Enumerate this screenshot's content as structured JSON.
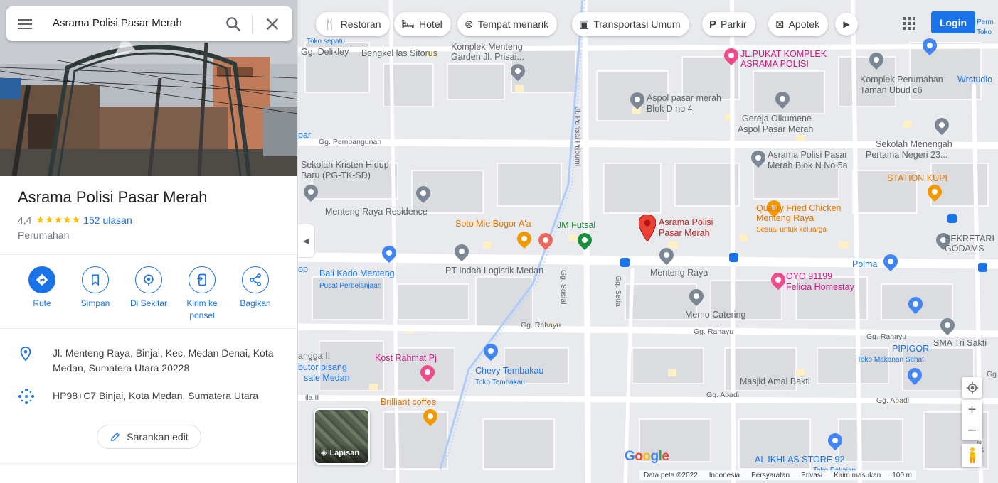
{
  "search": {
    "query": "Asrama Polisi Pasar Merah"
  },
  "place": {
    "name": "Asrama Polisi Pasar Merah",
    "rating": "4,4",
    "stars": "★★★★★",
    "reviews": "152 ulasan",
    "category": "Perumahan",
    "address": "Jl. Menteng Raya, Binjai, Kec. Medan Denai, Kota Medan, Sumatera Utara 20228",
    "plus_code": "HP98+C7 Binjai, Kota Medan, Sumatera Utara",
    "suggest_edit": "Sarankan edit"
  },
  "actions": [
    {
      "label": "Rute",
      "icon": "directions-icon"
    },
    {
      "label": "Simpan",
      "icon": "bookmark-icon"
    },
    {
      "label": "Di Sekitar",
      "icon": "nearby-icon"
    },
    {
      "label": "Kirim ke ponsel",
      "icon": "send-to-phone-icon"
    },
    {
      "label": "Bagikan",
      "icon": "share-icon"
    }
  ],
  "chips": [
    {
      "label": "Restoran",
      "icon": "restaurant-icon"
    },
    {
      "label": "Hotel",
      "icon": "hotel-icon"
    },
    {
      "label": "Tempat menarik",
      "icon": "attraction-icon"
    },
    {
      "label": "Transportasi Umum",
      "icon": "transit-icon"
    },
    {
      "label": "Parkir",
      "icon": "parking-icon"
    },
    {
      "label": "Apotek",
      "icon": "pharmacy-icon"
    }
  ],
  "login": "Login",
  "layers_label": "Lapisan",
  "footer": [
    "Data peta ©2022",
    "Indonesia",
    "Persyaratan",
    "Privasi",
    "Kirim masukan",
    "100 m"
  ],
  "map_labels": {
    "toko_sepatu": "Toko sepatu",
    "gg_delikley": "Gg. Delikley",
    "bengkel": "Bengkel las Sitorus",
    "komplek_menteng": "Komplek Menteng",
    "garden": "Garden Jl. Prisai...",
    "jl_pukat_1": "JL.PUKAT KOMPLEK",
    "jl_pukat_2": "ASRAMA POLISI",
    "komplek_perumahan": "Komplek Perumahan",
    "taman_ubud": "Taman Ubud c6",
    "wrstudio": "Wrstudio",
    "perm_top": "Perm",
    "toko_top": "Toko",
    "aspol_1": "Aspol pasar merah",
    "aspol_2": "Blok D no 4",
    "gereja_1": "Gereja Oikumene",
    "gereja_2": "Aspol Pasar Merah",
    "gg_pembangunan": "Gg. Pembangunan",
    "sekolah_kristen_1": "Sekolah Kristen Hidup",
    "sekolah_kristen_2": "Baru (PG-TK-SD)",
    "jl_perisai": "Jl. Perisai Pribumi",
    "asrama_blok_1": "Asrama Polisi Pasar",
    "asrama_blok_2": "Merah Blok N No 5a",
    "smp_1": "Sekolah Menengah",
    "smp_2": "Pertama Negeri 23...",
    "station_kupi": "STATION KUPI",
    "menteng_residence": "Menteng Raya Residence",
    "qfc_1": "Quality Fried Chicken",
    "qfc_2": "Menteng Raya",
    "qfc_3": "Sesuai untuk keluarga",
    "soto": "Soto Mie Bogor A'a",
    "jm_futsal": "JM Futsal",
    "asrama_main_1": "Asrama Polisi",
    "asrama_main_2": "Pasar Merah",
    "sekretari_1": "SEKRETARI",
    "sekretari_2": "GODAMS",
    "pt_indah": "PT Indah Logistik Medan",
    "menteng_raya": "Menteng Raya",
    "polma": "Polma",
    "bali_kado_1": "Bali Kado Menteng",
    "bali_kado_2": "Pusat Perbelanjaan",
    "gg_sosial": "Gg. Sosial",
    "gg_setia": "Gg. Setia",
    "oyo_1": "OYO 91199",
    "oyo_2": "Felicia Homestay",
    "memo": "Memo Catering",
    "gg_rahayu_1": "Gg. Rahayu",
    "gg_rahayu_2": "Gg. Rahayu",
    "gg_rahayu_3": "Gg. Rahayu",
    "sma": "SMA Tri Sakti",
    "pipigor_1": "PIPIGOR",
    "pipigor_2": "Toko Makanan Sehat",
    "kost": "Kost Rahmat Pj",
    "chevy_1": "Chevy Tembakau",
    "chevy_2": "Toko Tembakau",
    "anggaII": "angga II",
    "distributor_1": "butor pisang",
    "distributor_2": "sale Medan",
    "masjid": "Masjid Amal Bakti",
    "gg_abadi_1": "Gg. Abadi",
    "gg_abadi_2": "Gg. Abadi",
    "brilliant": "Brilliant coffee",
    "al_ikhlas_1": "AL IKHLAS STORE 92",
    "al_ikhlas_2": "Toko Pakaian",
    "gg_left": "Gg",
    "par": "par",
    "op": "op",
    "ilaII": "ila II",
    "pajar": "Pajar",
    "gg_right": "Gg."
  }
}
